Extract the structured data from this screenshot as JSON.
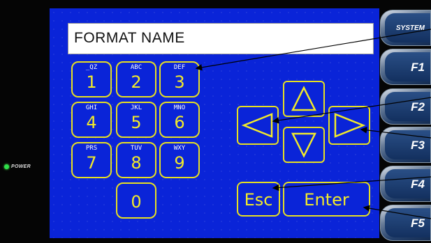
{
  "power": {
    "label": "POWER",
    "led_color": "#2ee04a"
  },
  "display": {
    "name_field": "FORMAT NAME"
  },
  "keypad": {
    "keys": [
      {
        "sub": "_QZ",
        "digit": "1"
      },
      {
        "sub": "ABC",
        "digit": "2"
      },
      {
        "sub": "DEF",
        "digit": "3"
      },
      {
        "sub": "GHI",
        "digit": "4"
      },
      {
        "sub": "JKL",
        "digit": "5"
      },
      {
        "sub": "MNO",
        "digit": "6"
      },
      {
        "sub": "PRS",
        "digit": "7"
      },
      {
        "sub": "TUV",
        "digit": "8"
      },
      {
        "sub": "WXY",
        "digit": "9"
      },
      {
        "sub": "",
        "digit": "0"
      }
    ]
  },
  "nav": {
    "up": "up-arrow-icon",
    "down": "down-arrow-icon",
    "left": "left-arrow-icon",
    "right": "right-arrow-icon"
  },
  "actions": {
    "esc": "Esc",
    "enter": "Enter"
  },
  "function_keys": [
    "SYSTEM",
    "F1",
    "F2",
    "F3",
    "F4",
    "F5"
  ],
  "colors": {
    "screen": "#0a24d8",
    "key_outline": "#e8e020",
    "key_text": "#f2ea2a"
  }
}
